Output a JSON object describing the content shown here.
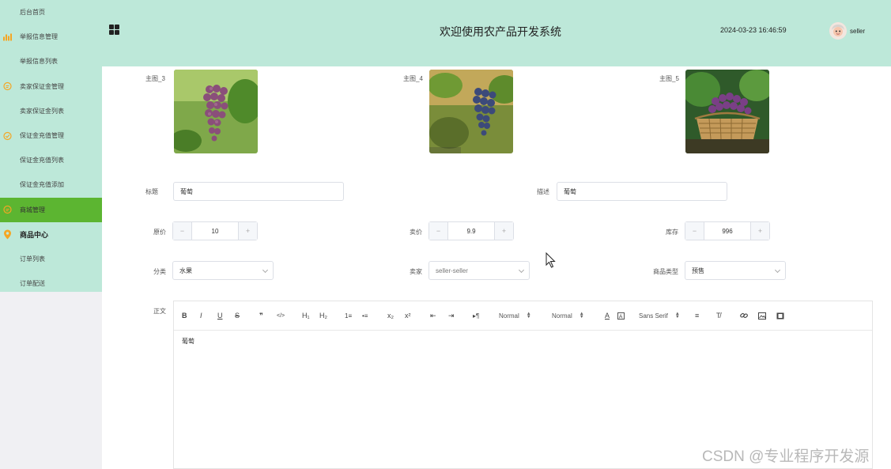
{
  "sidebar": {
    "items": [
      {
        "label": "后台首页",
        "type": "sub"
      },
      {
        "label": "举报信息管理",
        "type": "group",
        "icon": "bar-chart-icon"
      },
      {
        "label": "举报信息列表",
        "type": "sub"
      },
      {
        "label": "卖家保证金管理",
        "type": "group",
        "icon": "chat-icon"
      },
      {
        "label": "卖家保证金列表",
        "type": "sub"
      },
      {
        "label": "保证金充值管理",
        "type": "group",
        "icon": "check-circle-icon"
      },
      {
        "label": "保证金充值列表",
        "type": "sub"
      },
      {
        "label": "保证金充值添加",
        "type": "sub"
      },
      {
        "label": "商城管理",
        "type": "group-active",
        "icon": "chat-icon"
      },
      {
        "label": "商品中心",
        "type": "group-bold",
        "icon": "location-pin-icon"
      },
      {
        "label": "订单列表",
        "type": "sub"
      },
      {
        "label": "订单配送",
        "type": "sub"
      }
    ],
    "accent_color": "#f5a623",
    "active_color": "#5cb531"
  },
  "header": {
    "title": "欢迎使用农产品开发系统",
    "datetime": "2024-03-23 16:46:59",
    "username": "seller"
  },
  "form": {
    "images": [
      {
        "label": "主图_3"
      },
      {
        "label": "主图_4"
      },
      {
        "label": "主图_5"
      }
    ],
    "title_label": "标题",
    "title_value": "葡萄",
    "desc_label": "描述",
    "desc_value": "葡萄",
    "original_price_label": "原价",
    "original_price_value": "10",
    "sale_price_label": "卖价",
    "sale_price_value": "9.9",
    "stock_label": "库存",
    "stock_value": "996",
    "minus_symbol": "−",
    "plus_symbol": "+",
    "category_label": "分类",
    "category_value": "水果",
    "seller_label": "卖家",
    "seller_value": "seller-seller",
    "product_type_label": "商品类型",
    "product_type_value": "预售",
    "body_label": "正文",
    "body_text": "葡萄"
  },
  "editor_toolbar": {
    "bold": "B",
    "italic": "I",
    "underline": "U",
    "strike": "S",
    "quote": "❞",
    "code": "</>",
    "h1": "H₁",
    "h2": "H₂",
    "ordered_list": "1≡",
    "bullet_list": "•≡",
    "subscript": "x₂",
    "superscript": "x²",
    "outdent": "⇤",
    "indent": "⇥",
    "rtl": "▸¶",
    "size_select": "Normal",
    "header_select": "Normal",
    "font_color": "A",
    "font_family_select": "Sans Serif",
    "align": "≡",
    "clean": "T̸",
    "link": "🔗",
    "image": "▣",
    "video": "▤"
  },
  "watermark": "CSDN @专业程序开发源"
}
